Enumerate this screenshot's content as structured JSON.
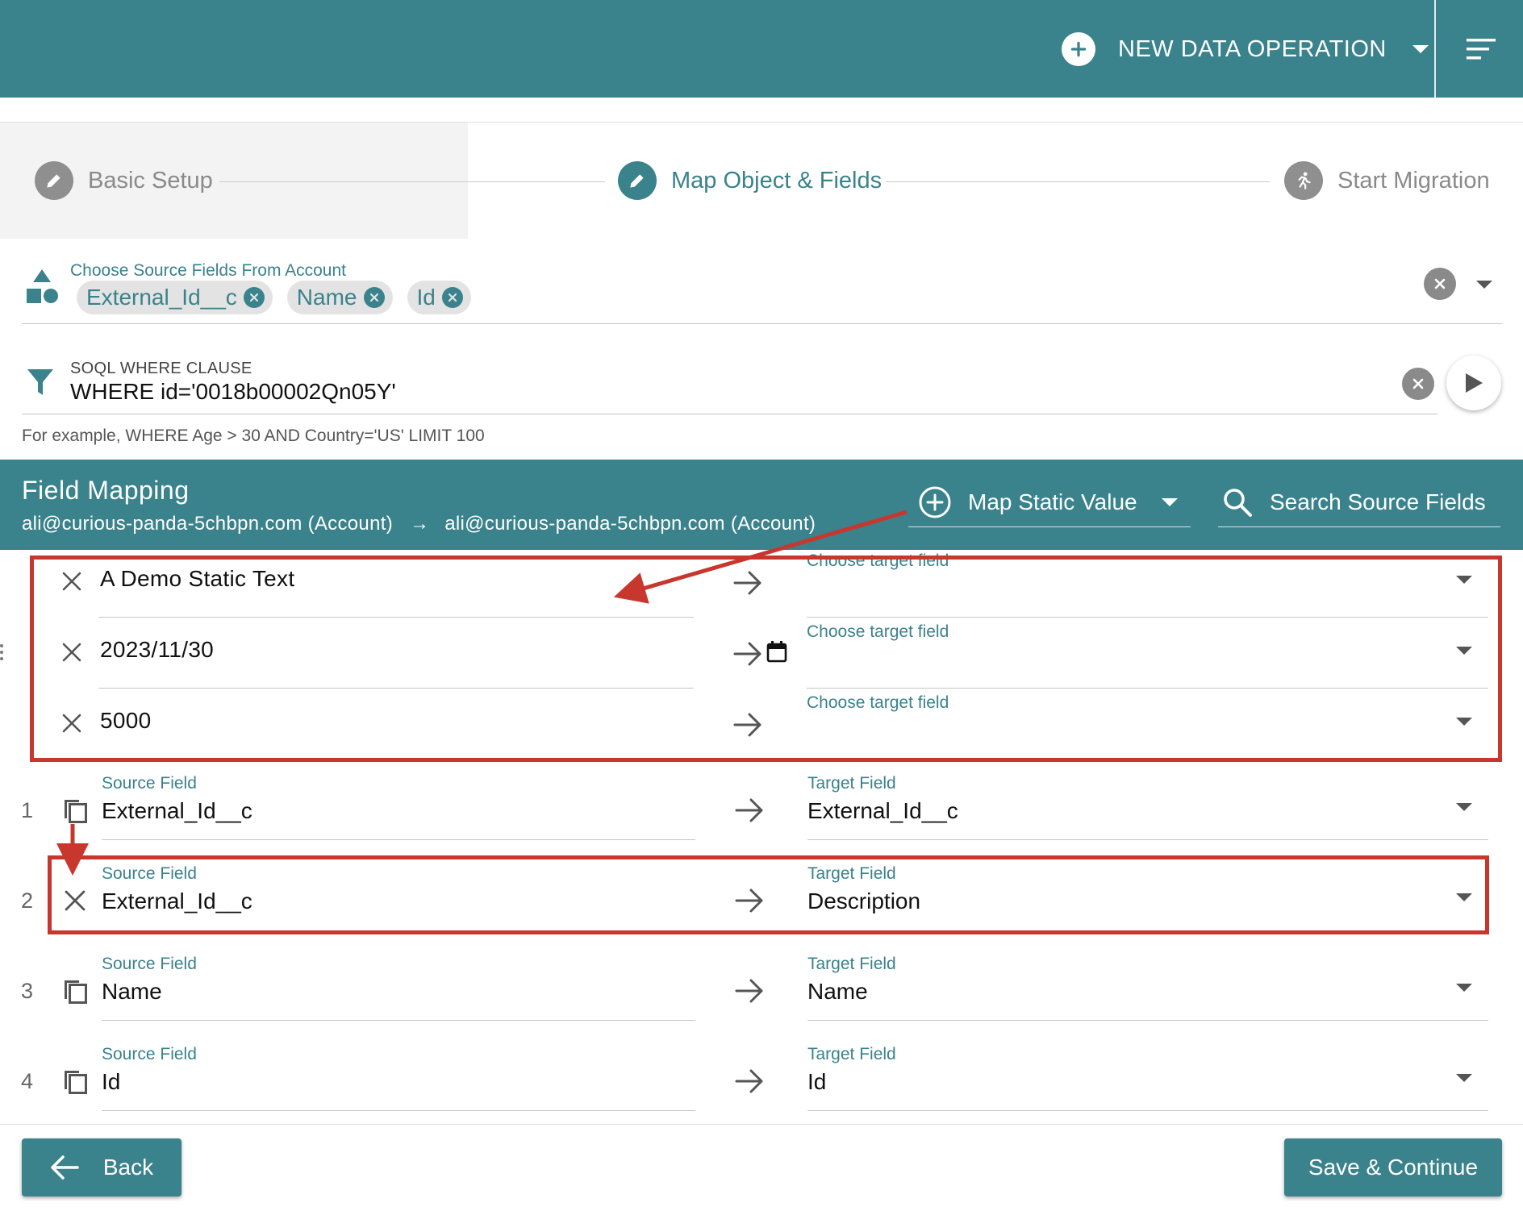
{
  "topbar": {
    "new_operation_label": "NEW DATA OPERATION",
    "menu_icon": "filter-list-icon"
  },
  "stepper": {
    "steps": [
      {
        "label": "Basic Setup",
        "state": "completed"
      },
      {
        "label": "Map Object & Fields",
        "state": "active"
      },
      {
        "label": "Start Migration",
        "state": "pending"
      }
    ]
  },
  "source_fields": {
    "label": "Choose Source Fields From Account",
    "chips": [
      "External_Id__c",
      "Name",
      "Id"
    ]
  },
  "soql": {
    "label": "SOQL WHERE CLAUSE",
    "value": "WHERE id='0018b00002Qn05Y'",
    "hint": "For example, WHERE Age > 30 AND Country='US' LIMIT 100"
  },
  "field_mapping": {
    "title": "Field Mapping",
    "source_org": "ali@curious-panda-5chbpn.com (Account)",
    "arrow": "→",
    "target_org": "ali@curious-panda-5chbpn.com (Account)",
    "map_static_label": "Map Static Value",
    "search_placeholder": "Search Source Fields"
  },
  "static_rows": [
    {
      "value": "A Demo Static Text",
      "target_label": "Choose target field",
      "has_calendar": false
    },
    {
      "value": "2023/11/30",
      "target_label": "Choose target field",
      "has_calendar": true
    },
    {
      "value": "5000",
      "target_label": "Choose target field",
      "has_calendar": false
    }
  ],
  "mapping_rows": [
    {
      "num": "1",
      "icon": "copy-icon",
      "source_label": "Source Field",
      "source": "External_Id__c",
      "target_label": "Target Field",
      "target": "External_Id__c"
    },
    {
      "num": "2",
      "icon": "close-icon",
      "source_label": "Source Field",
      "source": "External_Id__c",
      "target_label": "Target Field",
      "target": "Description"
    },
    {
      "num": "3",
      "icon": "copy-icon",
      "source_label": "Source Field",
      "source": "Name",
      "target_label": "Target Field",
      "target": "Name"
    },
    {
      "num": "4",
      "icon": "copy-icon",
      "source_label": "Source Field",
      "source": "Id",
      "target_label": "Target Field",
      "target": "Id"
    }
  ],
  "footer": {
    "back_label": "Back",
    "save_label": "Save & Continue"
  },
  "colors": {
    "brand": "#3a828c",
    "annotation": "#c8372d"
  }
}
